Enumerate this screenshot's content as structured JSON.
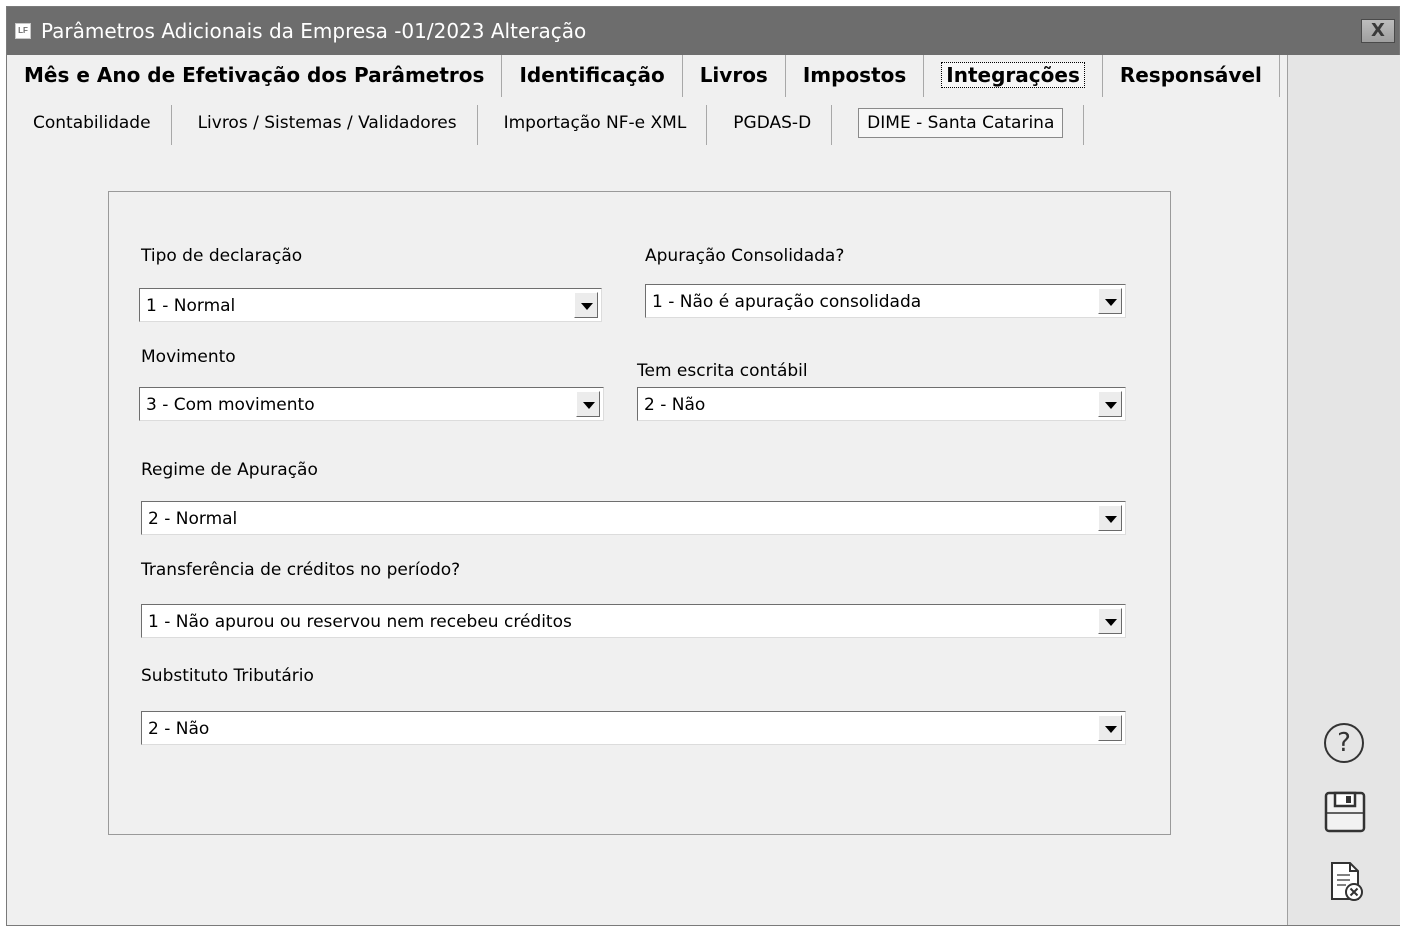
{
  "window": {
    "title": "Parâmetros Adicionais da Empresa -01/2023 Alteração",
    "icon_label": "LF",
    "close_label": "X"
  },
  "main_tabs": [
    {
      "label": "Mês e Ano de Efetivação dos Parâmetros",
      "active": false
    },
    {
      "label": "Identificação",
      "active": false
    },
    {
      "label": "Livros",
      "active": false
    },
    {
      "label": "Impostos",
      "active": false
    },
    {
      "label": "Integrações",
      "active": true
    },
    {
      "label": "Responsável",
      "active": false
    }
  ],
  "sub_tabs": [
    {
      "label": "Contabilidade",
      "active": false
    },
    {
      "label": "Livros / Sistemas / Validadores",
      "active": false
    },
    {
      "label": "Importação NF-e XML",
      "active": false
    },
    {
      "label": "PGDAS-D",
      "active": false
    },
    {
      "label": "DIME - Santa Catarina",
      "active": true
    }
  ],
  "form": {
    "tipo_declaracao": {
      "label": "Tipo de declaração",
      "value": "1 - Normal"
    },
    "apuracao_consolidada": {
      "label": "Apuração Consolidada?",
      "value": "1 - Não é apuração consolidada"
    },
    "movimento": {
      "label": "Movimento",
      "value": "3 - Com movimento"
    },
    "escrita_contabil": {
      "label": "Tem escrita contábil",
      "value": "2 - Não"
    },
    "regime_apuracao": {
      "label": "Regime de Apuração",
      "value": "2 - Normal"
    },
    "transferencia_creditos": {
      "label": "Transferência de créditos no período?",
      "value": "1 - Não apurou ou reservou nem recebeu créditos"
    },
    "substituto_tributario": {
      "label": "Substituto Tributário",
      "value": "2 - Não"
    }
  },
  "side_actions": {
    "help_label": "?"
  },
  "icons": [
    "help-icon",
    "save-icon",
    "cancel-document-icon",
    "close-icon",
    "dropdown-arrow-icon"
  ]
}
